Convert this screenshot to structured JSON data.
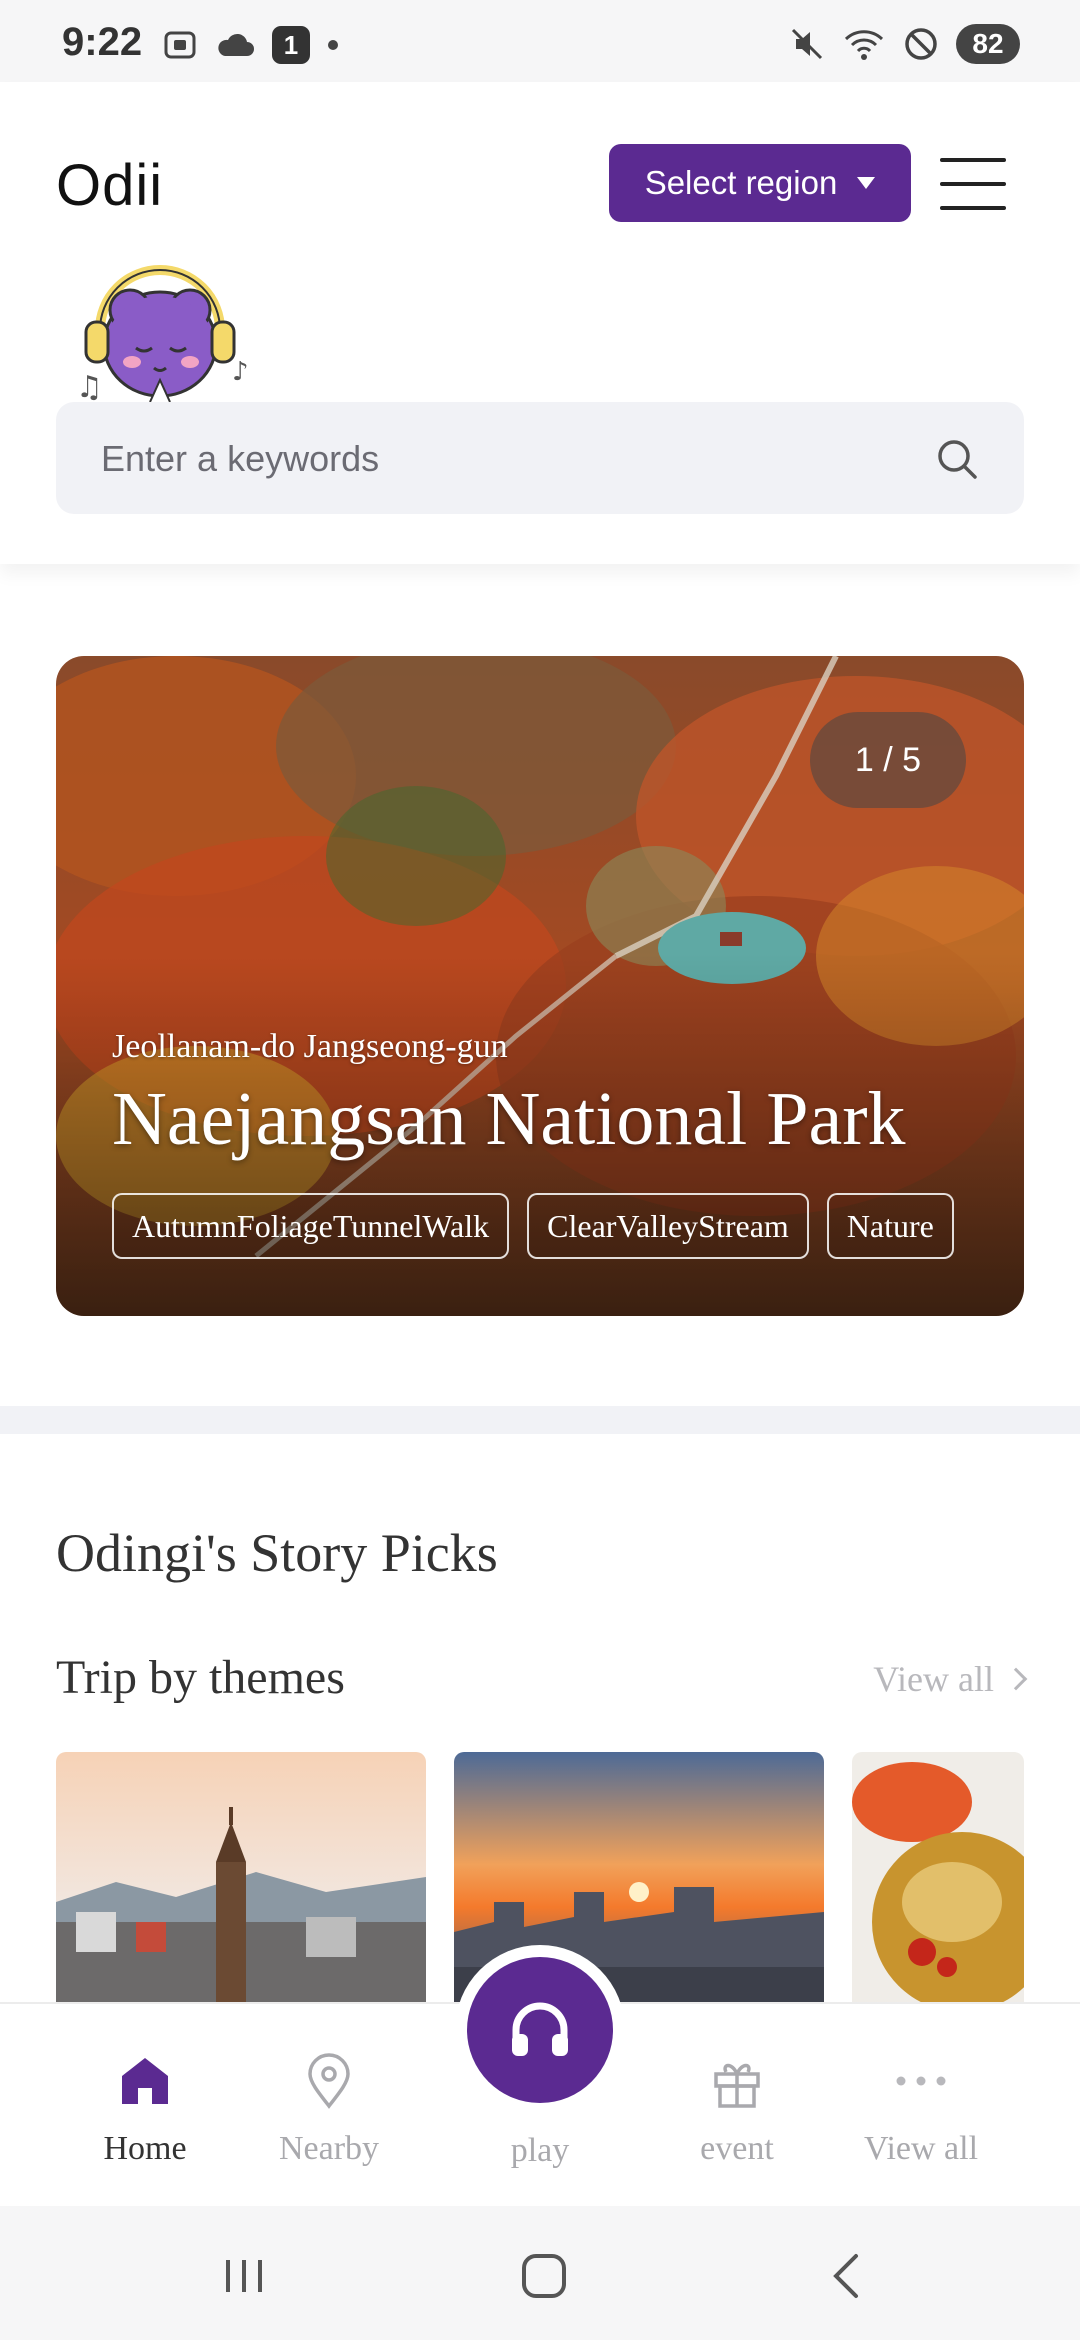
{
  "status_bar": {
    "time": "9:22",
    "notification_count": "1",
    "battery": "82"
  },
  "header": {
    "logo": "Odii",
    "region_button": "Select region",
    "search_placeholder": "Enter a keywords"
  },
  "hero": {
    "counter": "1 / 5",
    "region": "Jeollanam-do Jangseong-gun",
    "title": "Naejangsan National Park",
    "tags": [
      "AutumnFoliageTunnelWalk",
      "ClearValleyStream",
      "Nature"
    ]
  },
  "sections": {
    "story_picks_title": "Odingi's Story Picks",
    "themes_title": "Trip by themes",
    "view_all": "View all"
  },
  "bottom_nav": {
    "items": [
      {
        "label": "Home",
        "icon": "home-icon",
        "active": true
      },
      {
        "label": "Nearby",
        "icon": "location-pin-icon",
        "active": false
      },
      {
        "label": "play",
        "icon": "headphones-icon",
        "active": false
      },
      {
        "label": "event",
        "icon": "gift-icon",
        "active": false
      },
      {
        "label": "View all",
        "icon": "more-dots-icon",
        "active": false
      }
    ]
  },
  "colors": {
    "brand_purple": "#5b2a91",
    "inactive_gray": "#a9a9ad",
    "search_bg": "#f1f2f6"
  }
}
